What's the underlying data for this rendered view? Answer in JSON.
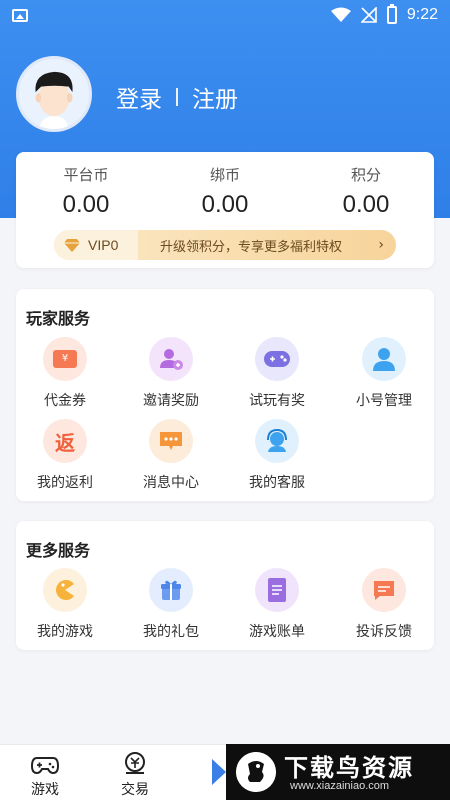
{
  "status_bar": {
    "time": "9:22",
    "icons": [
      "gallery-icon",
      "wifi-icon",
      "signal-icon",
      "battery-icon"
    ]
  },
  "profile": {
    "login_label": "登录",
    "register_label": "注册"
  },
  "wallet": {
    "platform_coin_label": "平台币",
    "platform_coin_value": "0.00",
    "bound_coin_label": "绑币",
    "bound_coin_value": "0.00",
    "points_label": "积分",
    "points_value": "0.00",
    "vip_level": "VIP0",
    "vip_promo": "升级领积分，专享更多福利特权",
    "vip_arrow": "›"
  },
  "player_services": {
    "title": "玩家服务",
    "items": [
      {
        "label": "代金券",
        "icon": "voucher-icon"
      },
      {
        "label": "邀请奖励",
        "icon": "invite-icon"
      },
      {
        "label": "试玩有奖",
        "icon": "gamepad-icon"
      },
      {
        "label": "小号管理",
        "icon": "account-icon"
      },
      {
        "label": "我的返利",
        "icon": "rebate-icon"
      },
      {
        "label": "消息中心",
        "icon": "message-icon"
      },
      {
        "label": "我的客服",
        "icon": "customer-service-icon"
      }
    ],
    "rebate_glyph": "返",
    "voucher_glyph": "¥"
  },
  "more_services": {
    "title": "更多服务",
    "items": [
      {
        "label": "我的游戏",
        "icon": "my-games-icon"
      },
      {
        "label": "我的礼包",
        "icon": "gift-icon"
      },
      {
        "label": "游戏账单",
        "icon": "bill-icon"
      },
      {
        "label": "投诉反馈",
        "icon": "feedback-icon"
      }
    ]
  },
  "bottom_nav": {
    "items": [
      {
        "label": "游戏",
        "icon": "game-controller-icon"
      },
      {
        "label": "交易",
        "icon": "trade-icon"
      }
    ]
  },
  "watermark": {
    "title": "下载鸟资源",
    "url": "www.xiazainiao.com"
  },
  "colors": {
    "header_blue": "#3d8ff0",
    "vip_gold": "#f7d49a",
    "page_bg": "#f4f5f9"
  }
}
